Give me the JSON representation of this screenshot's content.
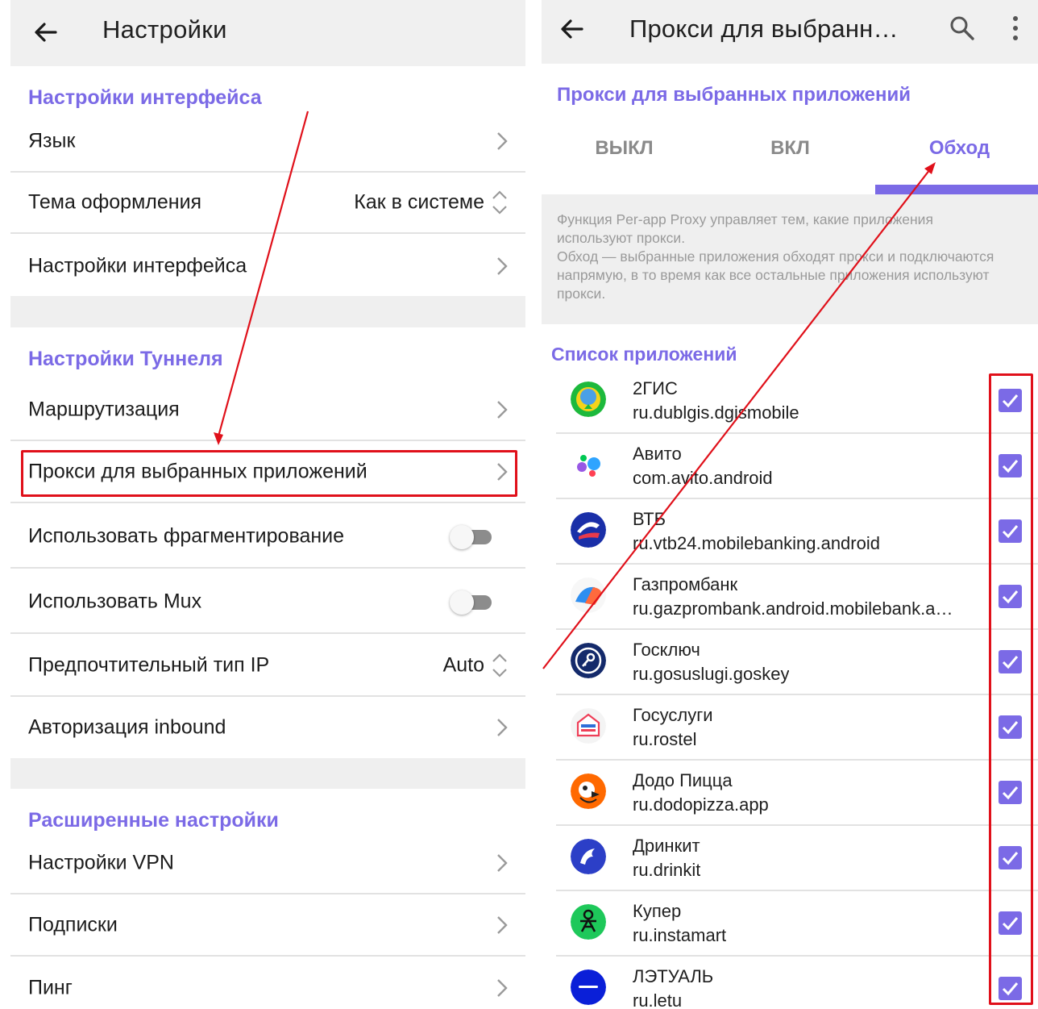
{
  "left": {
    "title": "Настройки",
    "sections": {
      "interface": "Настройки интерфейса",
      "tunnel": "Настройки Туннеля",
      "advanced": "Расширенные настройки"
    },
    "rows": {
      "language": "Язык",
      "theme": "Тема оформления",
      "theme_value": "Как в системе",
      "interface_settings": "Настройки интерфейса",
      "routing": "Маршрутизация",
      "per_app_proxy": "Прокси для выбранных приложений",
      "fragmentation": "Использовать фрагментирование",
      "mux": "Использовать Mux",
      "ip_type": "Предпочтительный тип IP",
      "ip_type_value": "Auto",
      "inbound_auth": "Авторизация inbound",
      "vpn_settings": "Настройки VPN",
      "subscriptions": "Подписки",
      "ping": "Пинг"
    },
    "toggles": {
      "fragmentation": false,
      "mux": false
    }
  },
  "right": {
    "title": "Прокси для выбранн…",
    "heading": "Прокси для выбранных приложений",
    "tabs": [
      "ВЫКЛ",
      "ВКЛ",
      "Обход"
    ],
    "active_tab": "Обход",
    "description": [
      "Функция Per-app Proxy управляет тем, какие приложения используют прокси.",
      "Обход — выбранные приложения обходят прокси и подключаются напрямую, в то время как все остальные приложения используют прокси."
    ],
    "list_title": "Список приложений",
    "apps": [
      {
        "name": "2ГИС",
        "package": "ru.dublgis.dgismobile",
        "checked": true,
        "icon": "2gis-icon"
      },
      {
        "name": "Авито",
        "package": "com.avito.android",
        "checked": true,
        "icon": "avito-icon"
      },
      {
        "name": "ВТБ",
        "package": "ru.vtb24.mobilebanking.android",
        "checked": true,
        "icon": "vtb-icon"
      },
      {
        "name": "Газпромбанк",
        "package": "ru.gazprombank.android.mobilebank.a…",
        "checked": true,
        "icon": "gazprombank-icon"
      },
      {
        "name": "Госключ",
        "package": "ru.gosuslugi.goskey",
        "checked": true,
        "icon": "goskey-icon"
      },
      {
        "name": "Госуслуги",
        "package": "ru.rostel",
        "checked": true,
        "icon": "gosuslugi-icon"
      },
      {
        "name": "Додо Пицца",
        "package": "ru.dodopizza.app",
        "checked": true,
        "icon": "dodo-icon"
      },
      {
        "name": "Дринкит",
        "package": "ru.drinkit",
        "checked": true,
        "icon": "drinkit-icon"
      },
      {
        "name": "Купер",
        "package": "ru.instamart",
        "checked": true,
        "icon": "kuper-icon"
      },
      {
        "name": "ЛЭТУАЛЬ",
        "package": "ru.letu",
        "checked": true,
        "icon": "letu-icon"
      }
    ]
  },
  "colors": {
    "accent": "#7b6ae6",
    "annotation": "#e0101a",
    "appbar": "#f0f0f0"
  }
}
